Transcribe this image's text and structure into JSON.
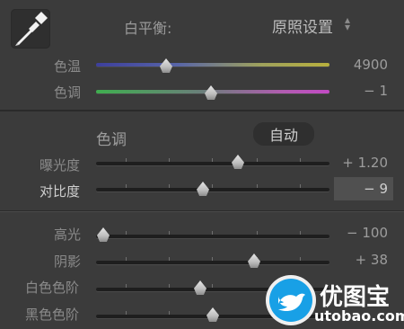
{
  "white_balance": {
    "label": "白平衡:",
    "preset": "原照设置",
    "temp": {
      "label": "色温",
      "value": "4900"
    },
    "tint": {
      "label": "色调",
      "value": "− 1"
    }
  },
  "tone": {
    "label": "色调",
    "auto_label": "自动",
    "exposure": {
      "label": "曝光度",
      "value": "+ 1.20"
    },
    "contrast": {
      "label": "对比度",
      "value": "− 9"
    }
  },
  "tones2": {
    "highlights": {
      "label": "高光",
      "value": "− 100"
    },
    "shadows": {
      "label": "阴影",
      "value": "+ 38"
    },
    "whites": {
      "label": "白色色阶"
    },
    "blacks": {
      "label": "黑色色阶"
    }
  },
  "watermark": {
    "title": "优图宝",
    "url": "utobao.com"
  },
  "icons": {
    "eyedropper": "eyedropper-icon",
    "up-down": "up-down-arrows-icon",
    "watermark": "bird-logo-icon"
  }
}
